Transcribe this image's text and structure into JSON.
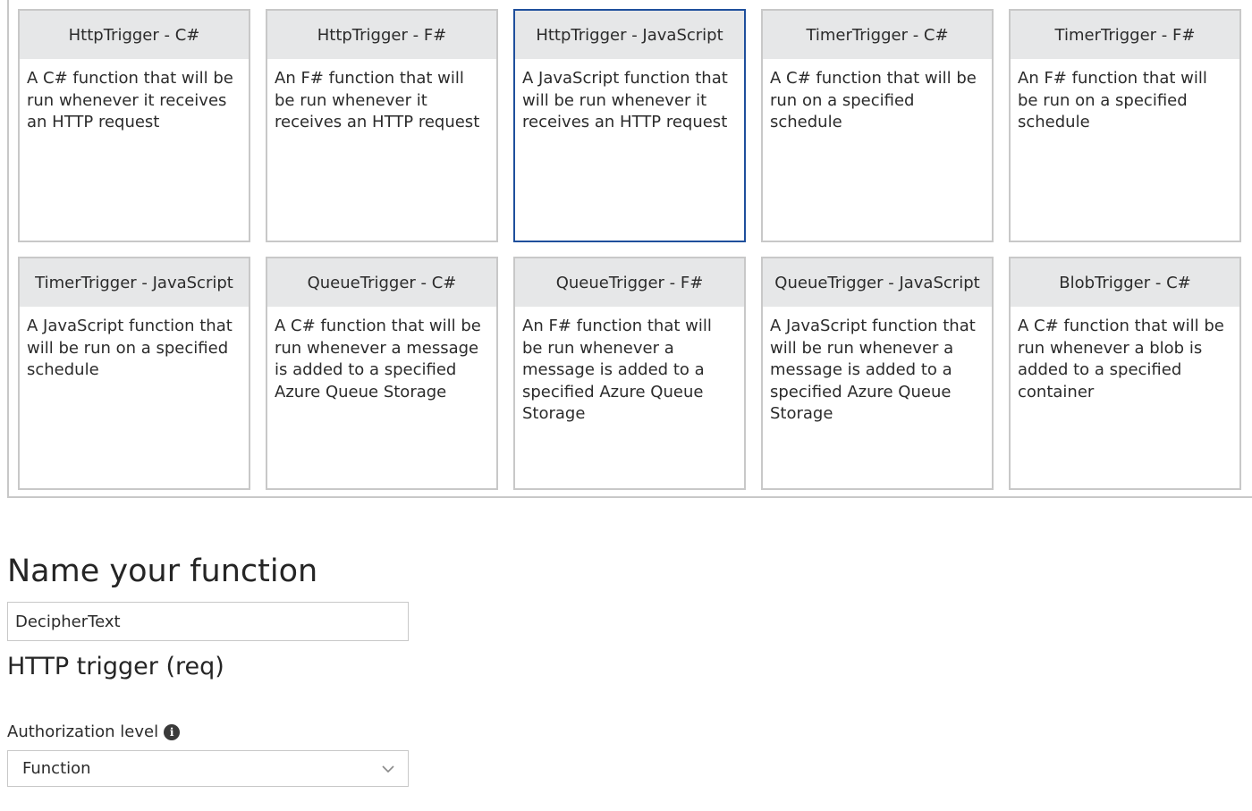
{
  "templates": [
    {
      "title": "HttpTrigger - C#",
      "description": "A C# function that will be run whenever it receives an HTTP request",
      "selected": false
    },
    {
      "title": "HttpTrigger - F#",
      "description": "An F# function that will be run whenever it receives an HTTP request",
      "selected": false
    },
    {
      "title": "HttpTrigger - JavaScript",
      "description": "A JavaScript function that will be run whenever it receives an HTTP request",
      "selected": true
    },
    {
      "title": "TimerTrigger - C#",
      "description": "A C# function that will be run on a specified schedule",
      "selected": false
    },
    {
      "title": "TimerTrigger - F#",
      "description": "An F# function that will be run on a specified schedule",
      "selected": false
    },
    {
      "title": "TimerTrigger - JavaScript",
      "description": "A JavaScript function that will be run on a specified schedule",
      "selected": false
    },
    {
      "title": "QueueTrigger - C#",
      "description": "A C# function that will be run whenever a message is added to a specified Azure Queue Storage",
      "selected": false
    },
    {
      "title": "QueueTrigger - F#",
      "description": "An F# function that will be run whenever a message is added to a specified Azure Queue Storage",
      "selected": false
    },
    {
      "title": "QueueTrigger - JavaScript",
      "description": "A JavaScript function that will be run whenever a message is added to a specified Azure Queue Storage",
      "selected": false
    },
    {
      "title": "BlobTrigger - C#",
      "description": "A C# function that will be run whenever a blob is added to a specified container",
      "selected": false
    }
  ],
  "name_section": {
    "title": "Name your function",
    "input_value": "DecipherText"
  },
  "trigger_section": {
    "title": "HTTP trigger (req)",
    "auth_label": "Authorization level",
    "auth_value": "Function"
  },
  "colors": {
    "selected_border": "#1f4f9c",
    "card_border": "#c8c8c8",
    "header_bg": "#e6e7e8"
  },
  "icons": {
    "info": "info-circle-icon",
    "dropdown": "chevron-down-icon"
  }
}
